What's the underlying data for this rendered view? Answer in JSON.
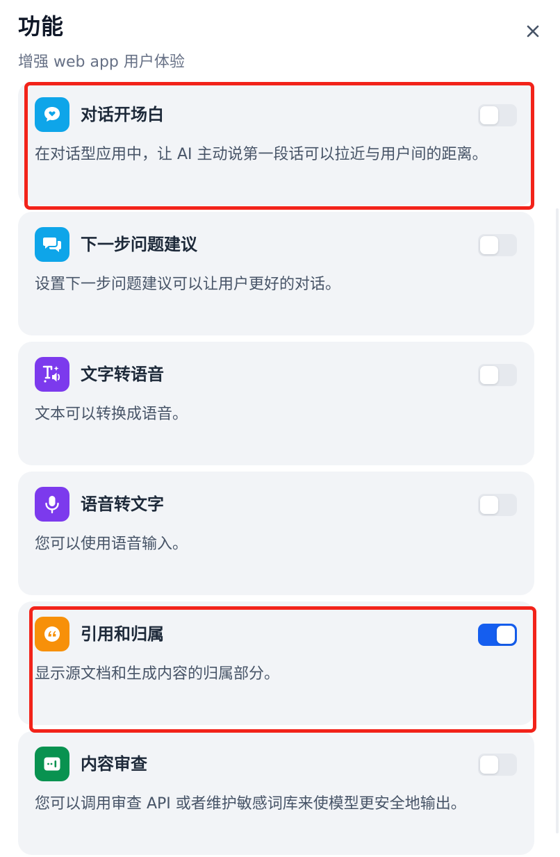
{
  "panel": {
    "title": "功能",
    "subtitle": "增强 web app 用户体验",
    "close_icon": "close-icon"
  },
  "features": [
    {
      "id": "opening",
      "title": "对话开场白",
      "description": "在对话型应用中，让 AI 主动说第一段话可以拉近与用户间的距离。",
      "enabled": false,
      "icon": "chat-heart-icon",
      "icon_color": "#0ea5e9"
    },
    {
      "id": "suggested",
      "title": "下一步问题建议",
      "description": "设置下一步问题建议可以让用户更好的对话。",
      "enabled": false,
      "icon": "chat-bubbles-icon",
      "icon_color": "#0ea5e9"
    },
    {
      "id": "tts",
      "title": "文字转语音",
      "description": "文本可以转换成语音。",
      "enabled": false,
      "icon": "text-to-speech-icon",
      "icon_color": "#7c3aed"
    },
    {
      "id": "stt",
      "title": "语音转文字",
      "description": "您可以使用语音输入。",
      "enabled": false,
      "icon": "microphone-icon",
      "icon_color": "#7c3aed"
    },
    {
      "id": "citation",
      "title": "引用和归属",
      "description": "显示源文档和生成内容的归属部分。",
      "enabled": true,
      "icon": "quote-icon",
      "icon_color": "#f79009"
    },
    {
      "id": "moderation",
      "title": "内容审查",
      "description": "您可以调用审查 API 或者维护敏感词库来使模型更安全地输出。",
      "enabled": false,
      "icon": "moderation-icon",
      "icon_color": "#099250"
    }
  ],
  "colors": {
    "toggle_on": "#155eef",
    "toggle_off": "#e6e9ee",
    "highlight": "#f2231a",
    "card_bg": "#f2f4f7"
  }
}
